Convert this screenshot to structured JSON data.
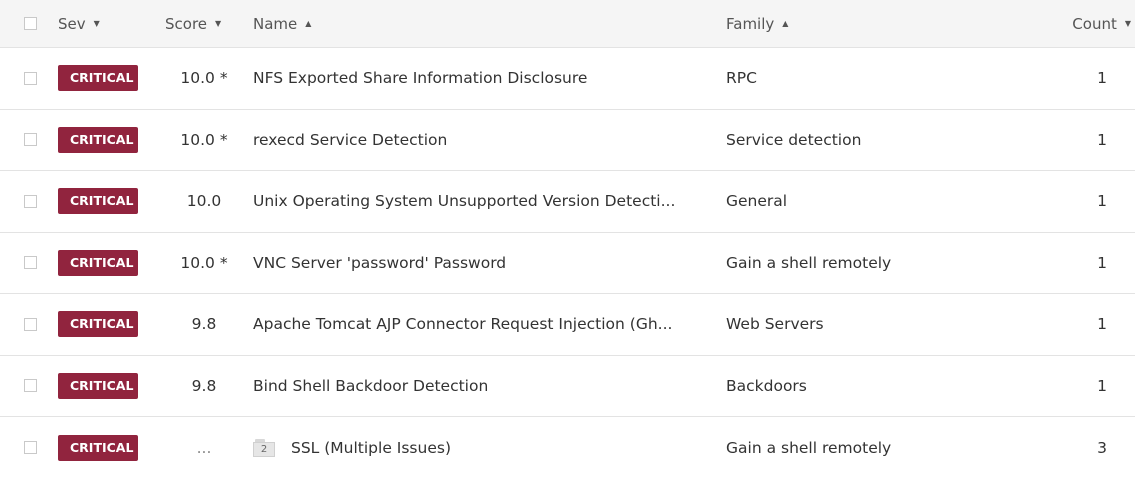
{
  "header": {
    "sev": "Sev",
    "score": "Score",
    "name": "Name",
    "family": "Family",
    "count": "Count",
    "sort_desc": "▼",
    "sort_asc": "▲"
  },
  "rows": [
    {
      "sev": "CRITICAL",
      "score": "10.0 *",
      "name": "NFS Exported Share Information Disclosure",
      "family": "RPC",
      "count": "1"
    },
    {
      "sev": "CRITICAL",
      "score": "10.0 *",
      "name": "rexecd Service Detection",
      "family": "Service detection",
      "count": "1"
    },
    {
      "sev": "CRITICAL",
      "score": "10.0",
      "name": "Unix Operating System Unsupported Version Detecti...",
      "family": "General",
      "count": "1"
    },
    {
      "sev": "CRITICAL",
      "score": "10.0 *",
      "name": "VNC Server 'password' Password",
      "family": "Gain a shell remotely",
      "count": "1"
    },
    {
      "sev": "CRITICAL",
      "score": "9.8",
      "name": "Apache Tomcat AJP Connector Request Injection (Gh...",
      "family": "Web Servers",
      "count": "1"
    },
    {
      "sev": "CRITICAL",
      "score": "9.8",
      "name": "Bind Shell Backdoor Detection",
      "family": "Backdoors",
      "count": "1"
    },
    {
      "sev": "CRITICAL",
      "score": "...",
      "group_count": "2",
      "name": "SSL (Multiple Issues)",
      "family": "Gain a shell remotely",
      "count": "3"
    }
  ],
  "colors": {
    "critical": "#91243e"
  }
}
